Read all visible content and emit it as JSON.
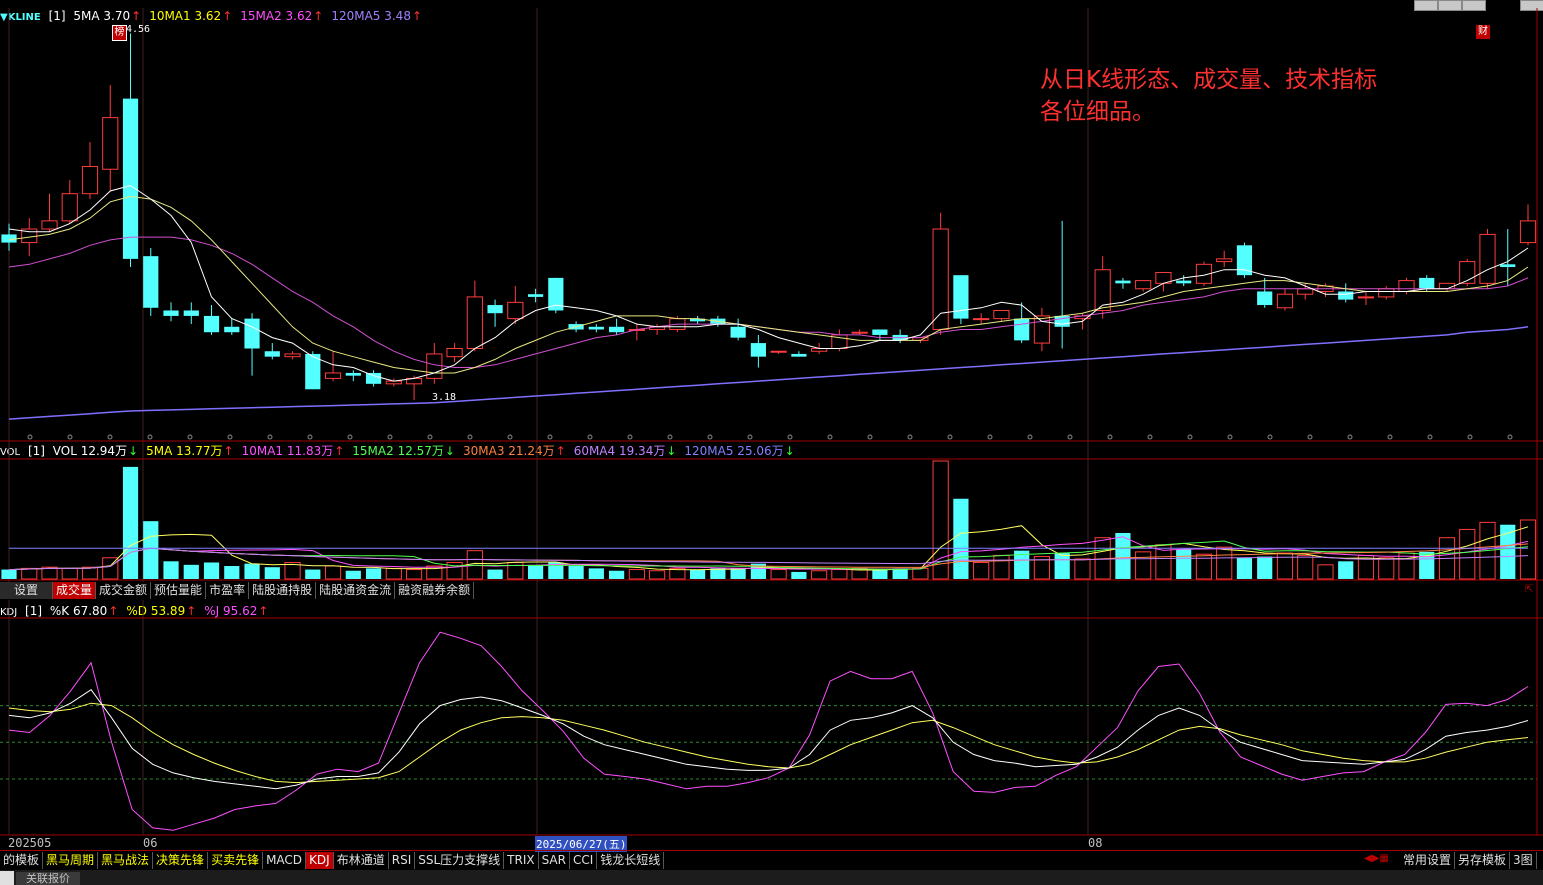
{
  "kline": {
    "name": "▼KLINE",
    "param": "[1]",
    "legend": [
      {
        "label": "5MA",
        "value": "3.70",
        "dir": "↑",
        "color": "#ffffff"
      },
      {
        "label": "10MA1",
        "value": "3.62",
        "dir": "↑",
        "color": "#ffff00"
      },
      {
        "label": "15MA2",
        "value": "3.62",
        "dir": "↑",
        "color": "#ff50ff"
      },
      {
        "label": "120MA5",
        "value": "3.48",
        "dir": "↑",
        "color": "#a080ff"
      }
    ],
    "high_label": "4.56",
    "low_label": "3.18",
    "badge_left": "榜",
    "badge_right": "财",
    "candles": [
      [
        3.82,
        3.79,
        3.86,
        3.76
      ],
      [
        3.79,
        3.84,
        3.88,
        3.74
      ],
      [
        3.84,
        3.87,
        3.97,
        3.83
      ],
      [
        3.87,
        3.97,
        4.02,
        3.86
      ],
      [
        3.97,
        4.07,
        4.16,
        3.95
      ],
      [
        4.06,
        4.25,
        4.37,
        3.98
      ],
      [
        4.32,
        3.73,
        4.56,
        3.7
      ],
      [
        3.74,
        3.55,
        3.77,
        3.52
      ],
      [
        3.54,
        3.52,
        3.57,
        3.5
      ],
      [
        3.54,
        3.52,
        3.57,
        3.49
      ],
      [
        3.52,
        3.46,
        3.56,
        3.45
      ],
      [
        3.48,
        3.46,
        3.51,
        3.45
      ],
      [
        3.51,
        3.4,
        3.53,
        3.3
      ],
      [
        3.39,
        3.37,
        3.42,
        3.36
      ],
      [
        3.37,
        3.38,
        3.39,
        3.36
      ],
      [
        3.38,
        3.25,
        3.39,
        3.25
      ],
      [
        3.29,
        3.31,
        3.39,
        3.28
      ],
      [
        3.31,
        3.3,
        3.32,
        3.28
      ],
      [
        3.31,
        3.27,
        3.32,
        3.26
      ],
      [
        3.27,
        3.28,
        3.29,
        3.26
      ],
      [
        3.27,
        3.29,
        3.3,
        3.21
      ],
      [
        3.29,
        3.38,
        3.42,
        3.27
      ],
      [
        3.37,
        3.4,
        3.42,
        3.35
      ],
      [
        3.4,
        3.59,
        3.65,
        3.39
      ],
      [
        3.56,
        3.53,
        3.58,
        3.48
      ],
      [
        3.51,
        3.57,
        3.63,
        3.49
      ],
      [
        3.6,
        3.59,
        3.62,
        3.57
      ],
      [
        3.66,
        3.54,
        3.66,
        3.53
      ],
      [
        3.49,
        3.47,
        3.5,
        3.46
      ],
      [
        3.48,
        3.47,
        3.49,
        3.46
      ],
      [
        3.48,
        3.46,
        3.51,
        3.45
      ],
      [
        3.47,
        3.47,
        3.49,
        3.43
      ],
      [
        3.47,
        3.48,
        3.49,
        3.45
      ],
      [
        3.47,
        3.51,
        3.52,
        3.46
      ],
      [
        3.51,
        3.5,
        3.52,
        3.49
      ],
      [
        3.51,
        3.49,
        3.52,
        3.48
      ],
      [
        3.48,
        3.44,
        3.51,
        3.43
      ],
      [
        3.42,
        3.37,
        3.45,
        3.33
      ],
      [
        3.39,
        3.39,
        3.39,
        3.38
      ],
      [
        3.38,
        3.37,
        3.39,
        3.37
      ],
      [
        3.39,
        3.4,
        3.42,
        3.38
      ],
      [
        3.4,
        3.45,
        3.47,
        3.39
      ],
      [
        3.46,
        3.46,
        3.47,
        3.45
      ],
      [
        3.47,
        3.45,
        3.47,
        3.43
      ],
      [
        3.45,
        3.43,
        3.47,
        3.42
      ],
      [
        3.43,
        3.44,
        3.44,
        3.42
      ],
      [
        3.47,
        3.84,
        3.9,
        3.45
      ],
      [
        3.67,
        3.51,
        3.67,
        3.49
      ],
      [
        3.51,
        3.51,
        3.53,
        3.49
      ],
      [
        3.51,
        3.54,
        3.54,
        3.5
      ],
      [
        3.51,
        3.43,
        3.57,
        3.42
      ],
      [
        3.42,
        3.52,
        3.55,
        3.39
      ],
      [
        3.52,
        3.48,
        3.87,
        3.4
      ],
      [
        3.51,
        3.52,
        3.53,
        3.47
      ],
      [
        3.54,
        3.69,
        3.74,
        3.51
      ],
      [
        3.65,
        3.64,
        3.66,
        3.62
      ],
      [
        3.62,
        3.65,
        3.65,
        3.61
      ],
      [
        3.64,
        3.68,
        3.68,
        3.61
      ],
      [
        3.65,
        3.64,
        3.67,
        3.63
      ],
      [
        3.64,
        3.71,
        3.72,
        3.63
      ],
      [
        3.72,
        3.73,
        3.76,
        3.7
      ],
      [
        3.78,
        3.67,
        3.79,
        3.66
      ],
      [
        3.61,
        3.56,
        3.66,
        3.55
      ],
      [
        3.55,
        3.6,
        3.62,
        3.54
      ],
      [
        3.6,
        3.62,
        3.64,
        3.58
      ],
      [
        3.61,
        3.63,
        3.64,
        3.59
      ],
      [
        3.61,
        3.58,
        3.64,
        3.57
      ],
      [
        3.59,
        3.59,
        3.61,
        3.56
      ],
      [
        3.59,
        3.62,
        3.63,
        3.58
      ],
      [
        3.61,
        3.65,
        3.66,
        3.6
      ],
      [
        3.66,
        3.62,
        3.67,
        3.61
      ],
      [
        3.62,
        3.64,
        3.64,
        3.61
      ],
      [
        3.64,
        3.72,
        3.73,
        3.63
      ],
      [
        3.64,
        3.82,
        3.84,
        3.62
      ],
      [
        3.71,
        3.7,
        3.84,
        3.63
      ],
      [
        3.79,
        3.87,
        3.93,
        3.78
      ]
    ],
    "ma5": [
      3.84,
      3.83,
      3.83,
      3.86,
      3.91,
      3.98,
      4.0,
      3.95,
      3.89,
      3.79,
      3.59,
      3.51,
      3.48,
      3.44,
      3.42,
      3.37,
      3.34,
      3.33,
      3.3,
      3.28,
      3.29,
      3.31,
      3.34,
      3.4,
      3.44,
      3.5,
      3.54,
      3.56,
      3.55,
      3.54,
      3.52,
      3.49,
      3.48,
      3.48,
      3.48,
      3.49,
      3.49,
      3.47,
      3.44,
      3.42,
      3.4,
      3.4,
      3.41,
      3.43,
      3.43,
      3.45,
      3.53,
      3.54,
      3.55,
      3.57,
      3.56,
      3.5,
      3.49,
      3.5,
      3.56,
      3.57,
      3.6,
      3.64,
      3.66,
      3.67,
      3.69,
      3.69,
      3.67,
      3.66,
      3.63,
      3.6,
      3.6,
      3.61,
      3.61,
      3.61,
      3.62,
      3.62,
      3.65,
      3.69,
      3.72,
      3.77
    ],
    "ma10": [
      3.8,
      3.81,
      3.82,
      3.84,
      3.88,
      3.94,
      3.96,
      3.95,
      3.92,
      3.87,
      3.8,
      3.72,
      3.64,
      3.56,
      3.48,
      3.42,
      3.39,
      3.37,
      3.35,
      3.33,
      3.32,
      3.31,
      3.31,
      3.33,
      3.36,
      3.4,
      3.43,
      3.46,
      3.48,
      3.5,
      3.52,
      3.52,
      3.52,
      3.51,
      3.51,
      3.5,
      3.49,
      3.48,
      3.47,
      3.46,
      3.45,
      3.44,
      3.43,
      3.43,
      3.43,
      3.43,
      3.47,
      3.48,
      3.49,
      3.5,
      3.51,
      3.51,
      3.52,
      3.53,
      3.55,
      3.56,
      3.57,
      3.59,
      3.61,
      3.62,
      3.63,
      3.64,
      3.65,
      3.65,
      3.64,
      3.63,
      3.62,
      3.61,
      3.61,
      3.61,
      3.61,
      3.61,
      3.62,
      3.63,
      3.65,
      3.7
    ],
    "ma15": [
      3.7,
      3.71,
      3.73,
      3.75,
      3.78,
      3.8,
      3.81,
      3.81,
      3.81,
      3.8,
      3.78,
      3.75,
      3.71,
      3.66,
      3.61,
      3.57,
      3.52,
      3.48,
      3.43,
      3.39,
      3.36,
      3.34,
      3.33,
      3.33,
      3.34,
      3.36,
      3.38,
      3.4,
      3.42,
      3.44,
      3.45,
      3.47,
      3.48,
      3.49,
      3.49,
      3.49,
      3.49,
      3.48,
      3.47,
      3.46,
      3.46,
      3.45,
      3.45,
      3.44,
      3.44,
      3.44,
      3.46,
      3.47,
      3.47,
      3.48,
      3.49,
      3.5,
      3.51,
      3.52,
      3.53,
      3.54,
      3.56,
      3.57,
      3.58,
      3.59,
      3.61,
      3.62,
      3.62,
      3.62,
      3.62,
      3.62,
      3.62,
      3.62,
      3.62,
      3.62,
      3.62,
      3.62,
      3.62,
      3.62,
      3.63,
      3.66
    ],
    "ma120": [
      3.14,
      3.145,
      3.15,
      3.155,
      3.16,
      3.165,
      3.17,
      3.172,
      3.174,
      3.176,
      3.178,
      3.18,
      3.182,
      3.184,
      3.186,
      3.188,
      3.19,
      3.192,
      3.194,
      3.196,
      3.198,
      3.2,
      3.205,
      3.21,
      3.215,
      3.22,
      3.225,
      3.23,
      3.235,
      3.24,
      3.245,
      3.25,
      3.255,
      3.26,
      3.265,
      3.27,
      3.275,
      3.28,
      3.285,
      3.29,
      3.295,
      3.3,
      3.305,
      3.31,
      3.315,
      3.32,
      3.325,
      3.33,
      3.335,
      3.34,
      3.345,
      3.35,
      3.355,
      3.36,
      3.365,
      3.37,
      3.375,
      3.38,
      3.385,
      3.39,
      3.395,
      3.4,
      3.405,
      3.41,
      3.415,
      3.42,
      3.425,
      3.43,
      3.435,
      3.44,
      3.445,
      3.45,
      3.46,
      3.465,
      3.47,
      3.48
    ],
    "price_range": [
      3.1,
      4.58
    ]
  },
  "vol": {
    "name": "VOL",
    "param": "[1]",
    "legend": [
      {
        "label": "VOL",
        "value": "12.94万",
        "dir": "↓",
        "color": "#ffffff"
      },
      {
        "label": "5MA",
        "value": "13.77万",
        "dir": "↑",
        "color": "#ffff00"
      },
      {
        "label": "10MA1",
        "value": "11.83万",
        "dir": "↑",
        "color": "#ff50ff"
      },
      {
        "label": "15MA2",
        "value": "12.57万",
        "dir": "↓",
        "color": "#50ff50"
      },
      {
        "label": "30MA3",
        "value": "21.24万",
        "dir": "↑",
        "color": "#ff8040"
      },
      {
        "label": "60MA4",
        "value": "19.34万",
        "dir": "↓",
        "color": "#c080ff"
      },
      {
        "label": "120MA5",
        "value": "25.06万",
        "dir": "↓",
        "color": "#8080ff"
      }
    ],
    "values": [
      8,
      9,
      10,
      9,
      10,
      18,
      95,
      49,
      15,
      12,
      14,
      11,
      13,
      10,
      14,
      8,
      11,
      7,
      9,
      9,
      8,
      11,
      14,
      24,
      8,
      14,
      12,
      14,
      11,
      9,
      7,
      8,
      7,
      9,
      8,
      9,
      9,
      13,
      8,
      6,
      7,
      8,
      9,
      8,
      9,
      9,
      100,
      68,
      14,
      20,
      24,
      19,
      22,
      17,
      35,
      39,
      23,
      29,
      25,
      21,
      27,
      18,
      19,
      22,
      20,
      12,
      15,
      20,
      18,
      22,
      23,
      35,
      42,
      48,
      46,
      50
    ],
    "range": [
      0,
      100
    ]
  },
  "tabs_mid": [
    "设置",
    "成交量",
    "成交金额",
    "预估量能",
    "市盈率",
    "陆股通持股",
    "陆股通资金流",
    "融资融券余额"
  ],
  "kdj": {
    "name": "KDJ",
    "param": "[1]",
    "legend": [
      {
        "label": "%K",
        "value": "67.80",
        "dir": "↑",
        "color": "#ffffff"
      },
      {
        "label": "%D",
        "value": "53.89",
        "dir": "↑",
        "color": "#ffff00"
      },
      {
        "label": "%J",
        "value": "95.62",
        "dir": "↑",
        "color": "#ff50ff"
      }
    ],
    "k": [
      72,
      70,
      74,
      82,
      93,
      70,
      45,
      32,
      25,
      21,
      18,
      16,
      14,
      12,
      15,
      20,
      22,
      22,
      25,
      42,
      65,
      80,
      85,
      87,
      84,
      78,
      72,
      65,
      55,
      48,
      44,
      40,
      36,
      32,
      30,
      28,
      27,
      27,
      29,
      40,
      60,
      68,
      70,
      74,
      80,
      70,
      50,
      40,
      35,
      33,
      30,
      31,
      32,
      38,
      46,
      60,
      72,
      78,
      72,
      60,
      50,
      45,
      40,
      35,
      34,
      33,
      32,
      34,
      36,
      44,
      55,
      58,
      60,
      63,
      67.8
    ],
    "d": [
      78,
      76,
      75,
      77,
      82,
      80,
      70,
      58,
      48,
      40,
      33,
      27,
      22,
      18,
      17,
      18,
      19,
      20,
      21,
      26,
      38,
      50,
      60,
      66,
      70,
      71,
      70,
      68,
      64,
      60,
      55,
      50,
      46,
      42,
      38,
      35,
      32,
      30,
      29,
      32,
      40,
      48,
      54,
      60,
      66,
      68,
      62,
      55,
      48,
      43,
      38,
      35,
      33,
      34,
      38,
      44,
      52,
      60,
      63,
      61,
      56,
      52,
      48,
      43,
      40,
      37,
      35,
      34,
      34,
      37,
      42,
      46,
      50,
      52,
      53.89
    ],
    "j": [
      60,
      58,
      72,
      92,
      115,
      50,
      -5,
      -20,
      -22,
      -17,
      -12,
      -5,
      -2,
      0,
      11,
      24,
      28,
      26,
      33,
      74,
      115,
      140,
      135,
      129,
      112,
      92,
      76,
      59,
      37,
      24,
      22,
      20,
      16,
      12,
      14,
      14,
      17,
      21,
      29,
      56,
      100,
      108,
      102,
      102,
      108,
      74,
      26,
      10,
      9,
      13,
      14,
      23,
      30,
      46,
      62,
      92,
      112,
      114,
      90,
      58,
      38,
      31,
      24,
      19,
      22,
      25,
      26,
      34,
      40,
      58,
      81,
      82,
      80,
      85,
      95.62
    ],
    "range": [
      -25,
      150
    ],
    "guides": [
      80,
      50,
      20
    ]
  },
  "dates": {
    "start": "202505",
    "m06": "06",
    "selected": "2025/06/27(五)",
    "m08": "08"
  },
  "annotation": {
    "line1": "从日K线形态、成交量、技术指标",
    "line2": "各位细品。"
  },
  "tabs_bottom": [
    "的模板",
    "黑马周期",
    "黑马战法",
    "决策先锋",
    "买卖先锋",
    "MACD",
    "KDJ",
    "布林通道",
    "RSI",
    "SSL压力支撑线",
    "TRIX",
    "SAR",
    "CCI",
    "钱龙长短线"
  ],
  "tabs_bottom_right": [
    "常用设置",
    "另存模板",
    "3图"
  ],
  "footer": "关联报价",
  "colors": {
    "up": "#ff3c3c",
    "down": "#54ffff",
    "border_red": "#a00000"
  }
}
